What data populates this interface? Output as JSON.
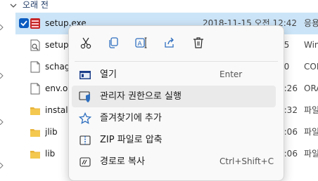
{
  "group": {
    "label": "오래 전"
  },
  "files": [
    {
      "name": "setup.exe",
      "date": "2018-11-15 오전 12:42",
      "type": "응용",
      "icon": "exe-setup-icon",
      "selected": true
    },
    {
      "name": "setup.l",
      "date": "05",
      "type": "Win",
      "icon": "config-file-icon"
    },
    {
      "name": "schage",
      "date": "50",
      "type": "CON",
      "icon": "document-file-icon"
    },
    {
      "name": "env.ora",
      "date": "1:26",
      "type": "ORA",
      "icon": "document-file-icon"
    },
    {
      "name": "install",
      "date": "2:32",
      "type": "파일",
      "icon": "folder-icon"
    },
    {
      "name": "jlib",
      "date": "2:06",
      "type": "파일",
      "icon": "folder-icon"
    },
    {
      "name": "lib",
      "date": "2:06",
      "type": "파일",
      "icon": "folder-icon"
    }
  ],
  "context_menu": {
    "toolbar": [
      {
        "name": "cut-icon"
      },
      {
        "name": "copy-icon"
      },
      {
        "name": "rename-icon"
      },
      {
        "name": "share-icon"
      },
      {
        "name": "delete-icon"
      }
    ],
    "items": [
      {
        "label": "열기",
        "shortcut": "Enter",
        "icon": "open-app-icon"
      },
      {
        "label": "관리자 권한으로 실행",
        "shortcut": "",
        "icon": "admin-shield-icon",
        "highlighted": true
      },
      {
        "label": "즐겨찾기에 추가",
        "shortcut": "",
        "icon": "star-icon"
      },
      {
        "label": "ZIP 파일로 압축",
        "shortcut": "",
        "icon": "zip-archive-icon"
      },
      {
        "label": "경로로 복사",
        "shortcut": "Ctrl+Shift+C",
        "icon": "copy-path-icon"
      }
    ]
  },
  "colors": {
    "accent": "#0b5cc1",
    "selection": "#cce4f7",
    "folder": "#e8b33a",
    "hover": "#eaeaea"
  }
}
